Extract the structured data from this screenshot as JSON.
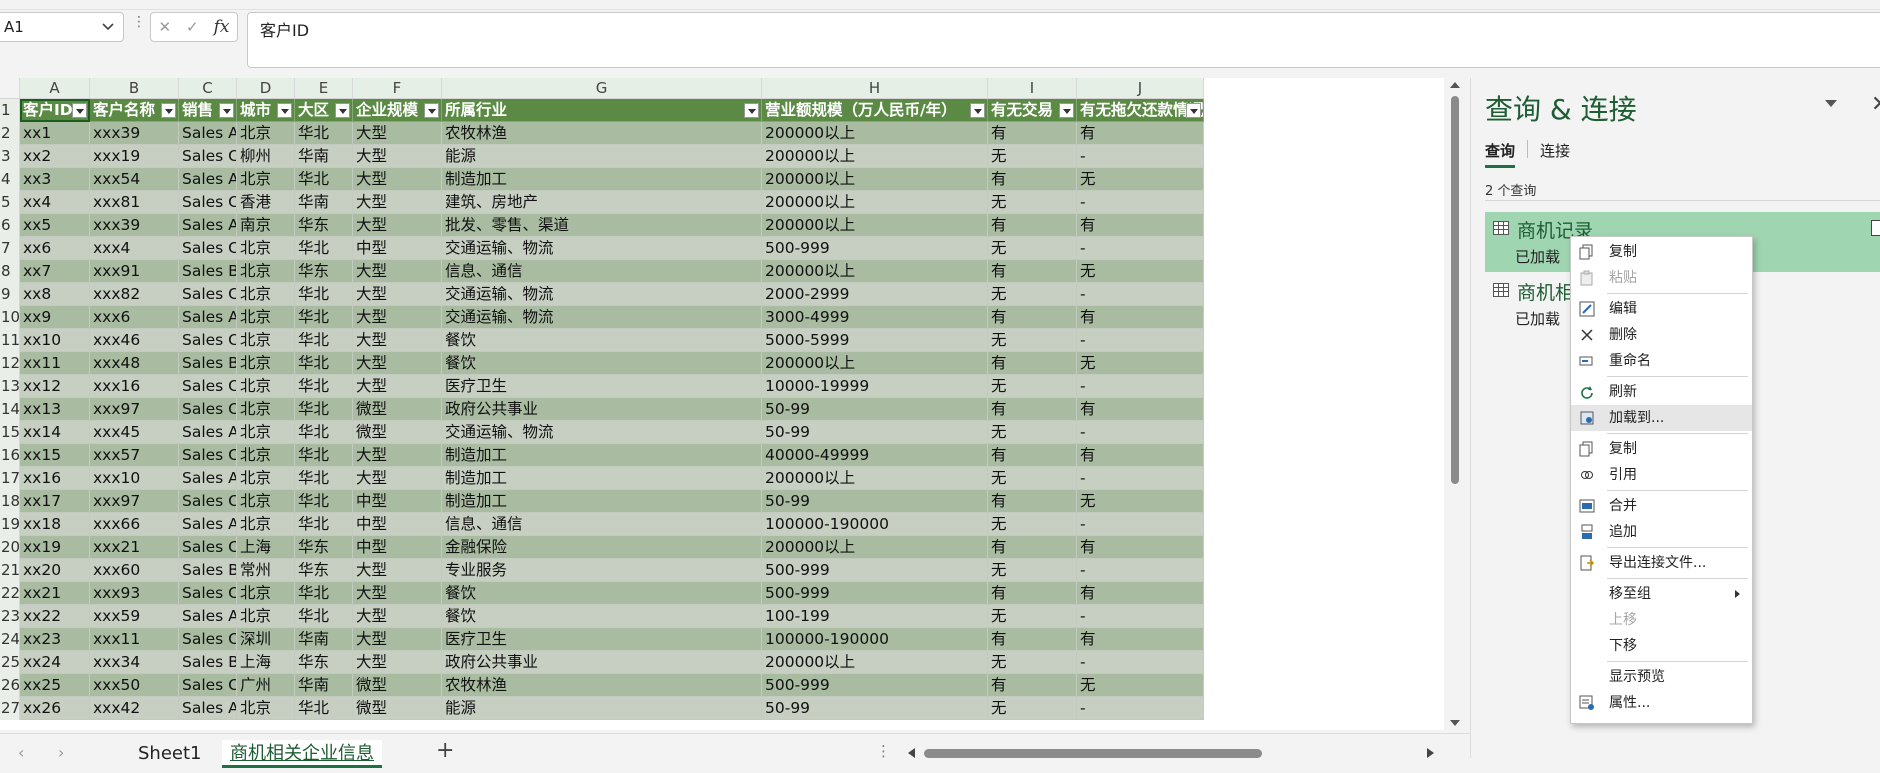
{
  "formula_bar": {
    "name_box": "A1",
    "formula": "客户ID"
  },
  "columns": [
    "A",
    "B",
    "C",
    "D",
    "E",
    "F",
    "G",
    "H",
    "I",
    "J"
  ],
  "table": {
    "headers": [
      "客户ID",
      "客户名称",
      "销售",
      "城市",
      "大区",
      "企业规模",
      "所属行业",
      "营业额规模（万人民币/年）",
      "有无交易",
      "有无拖欠还款情况"
    ],
    "rows": [
      [
        "xx1",
        "xxx39",
        "Sales A",
        "北京",
        "华北",
        "大型",
        "农牧林渔",
        "200000以上",
        "有",
        "有"
      ],
      [
        "xx2",
        "xxx19",
        "Sales C",
        "柳州",
        "华南",
        "大型",
        "能源",
        "200000以上",
        "无",
        "-"
      ],
      [
        "xx3",
        "xxx54",
        "Sales A",
        "北京",
        "华北",
        "大型",
        "制造加工",
        "200000以上",
        "有",
        "无"
      ],
      [
        "xx4",
        "xxx81",
        "Sales C",
        "香港",
        "华南",
        "大型",
        "建筑、房地产",
        "200000以上",
        "无",
        "-"
      ],
      [
        "xx5",
        "xxx39",
        "Sales A",
        "南京",
        "华东",
        "大型",
        "批发、零售、渠道",
        "200000以上",
        "有",
        "有"
      ],
      [
        "xx6",
        "xxx4",
        "Sales C",
        "北京",
        "华北",
        "中型",
        "交通运输、物流",
        "500-999",
        "无",
        "-"
      ],
      [
        "xx7",
        "xxx91",
        "Sales B",
        "北京",
        "华东",
        "大型",
        "信息、通信",
        "200000以上",
        "有",
        "无"
      ],
      [
        "xx8",
        "xxx82",
        "Sales C",
        "北京",
        "华北",
        "大型",
        "交通运输、物流",
        "2000-2999",
        "无",
        "-"
      ],
      [
        "xx9",
        "xxx6",
        "Sales A",
        "北京",
        "华北",
        "大型",
        "交通运输、物流",
        "3000-4999",
        "有",
        "有"
      ],
      [
        "xx10",
        "xxx46",
        "Sales C",
        "北京",
        "华北",
        "大型",
        "餐饮",
        "5000-5999",
        "无",
        "-"
      ],
      [
        "xx11",
        "xxx48",
        "Sales B",
        "北京",
        "华北",
        "大型",
        "餐饮",
        "200000以上",
        "有",
        "无"
      ],
      [
        "xx12",
        "xxx16",
        "Sales C",
        "北京",
        "华北",
        "大型",
        "医疗卫生",
        "10000-19999",
        "无",
        "-"
      ],
      [
        "xx13",
        "xxx97",
        "Sales C",
        "北京",
        "华北",
        "微型",
        "政府公共事业",
        "50-99",
        "有",
        "有"
      ],
      [
        "xx14",
        "xxx45",
        "Sales A",
        "北京",
        "华北",
        "微型",
        "交通运输、物流",
        "50-99",
        "无",
        "-"
      ],
      [
        "xx15",
        "xxx57",
        "Sales C",
        "北京",
        "华北",
        "大型",
        "制造加工",
        "40000-49999",
        "有",
        "有"
      ],
      [
        "xx16",
        "xxx10",
        "Sales A",
        "北京",
        "华北",
        "大型",
        "制造加工",
        "200000以上",
        "无",
        "-"
      ],
      [
        "xx17",
        "xxx97",
        "Sales C",
        "北京",
        "华北",
        "中型",
        "制造加工",
        "50-99",
        "有",
        "无"
      ],
      [
        "xx18",
        "xxx66",
        "Sales A",
        "北京",
        "华北",
        "中型",
        "信息、通信",
        "100000-190000",
        "无",
        "-"
      ],
      [
        "xx19",
        "xxx21",
        "Sales C",
        "上海",
        "华东",
        "中型",
        "金融保险",
        "200000以上",
        "有",
        "有"
      ],
      [
        "xx20",
        "xxx60",
        "Sales B",
        "常州",
        "华东",
        "大型",
        "专业服务",
        "500-999",
        "无",
        "-"
      ],
      [
        "xx21",
        "xxx93",
        "Sales C",
        "北京",
        "华北",
        "大型",
        "餐饮",
        "500-999",
        "有",
        "有"
      ],
      [
        "xx22",
        "xxx59",
        "Sales A",
        "北京",
        "华北",
        "大型",
        "餐饮",
        "100-199",
        "无",
        "-"
      ],
      [
        "xx23",
        "xxx11",
        "Sales C",
        "深圳",
        "华南",
        "大型",
        "医疗卫生",
        "100000-190000",
        "有",
        "有"
      ],
      [
        "xx24",
        "xxx34",
        "Sales B",
        "上海",
        "华东",
        "大型",
        "政府公共事业",
        "200000以上",
        "无",
        "-"
      ],
      [
        "xx25",
        "xxx50",
        "Sales C",
        "广州",
        "华南",
        "微型",
        "农牧林渔",
        "500-999",
        "有",
        "无"
      ],
      [
        "xx26",
        "xxx42",
        "Sales A",
        "北京",
        "华北",
        "微型",
        "能源",
        "50-99",
        "无",
        "-"
      ]
    ]
  },
  "sheet_tabs": [
    "Sheet1",
    "商机相关企业信息"
  ],
  "pane": {
    "title": "查询 & 连接",
    "tabs": [
      "查询",
      "连接"
    ],
    "count": "2 个查询",
    "queries": [
      {
        "name": "商机记录",
        "status": "已加载"
      },
      {
        "name": "商机相",
        "status": "已加载"
      }
    ]
  },
  "context_menu": [
    {
      "label": "复制",
      "icon": "copy-icon",
      "disabled": false
    },
    {
      "label": "粘贴",
      "icon": "paste-icon",
      "disabled": true
    },
    {
      "sep": true
    },
    {
      "label": "编辑",
      "icon": "edit-icon",
      "disabled": false
    },
    {
      "label": "删除",
      "icon": "delete-icon",
      "disabled": false
    },
    {
      "label": "重命名",
      "icon": "rename-icon",
      "disabled": false
    },
    {
      "sep": true
    },
    {
      "label": "刷新",
      "icon": "refresh-icon",
      "disabled": false
    },
    {
      "label": "加载到...",
      "icon": "load-to-icon",
      "disabled": false,
      "highlight": true
    },
    {
      "sep": true
    },
    {
      "label": "复制",
      "icon": "duplicate-icon",
      "disabled": false
    },
    {
      "label": "引用",
      "icon": "reference-icon",
      "disabled": false
    },
    {
      "sep": true
    },
    {
      "label": "合并",
      "icon": "merge-icon",
      "disabled": false
    },
    {
      "label": "追加",
      "icon": "append-icon",
      "disabled": false
    },
    {
      "sep": true
    },
    {
      "label": "导出连接文件...",
      "icon": "export-icon",
      "disabled": false
    },
    {
      "sep": true
    },
    {
      "label": "移至组",
      "disabled": false,
      "submenu": true
    },
    {
      "label": "上移",
      "disabled": true
    },
    {
      "label": "下移",
      "disabled": false
    },
    {
      "sep": true
    },
    {
      "label": "显示预览",
      "disabled": false
    },
    {
      "label": "属性...",
      "icon": "properties-icon",
      "disabled": false
    }
  ],
  "colors": {
    "header_green": "#5b8a44",
    "band_dark": "#a9bca2",
    "band_light": "#c6cfc2",
    "accent": "#1e7145",
    "selected_query": "#9fd6b1"
  }
}
